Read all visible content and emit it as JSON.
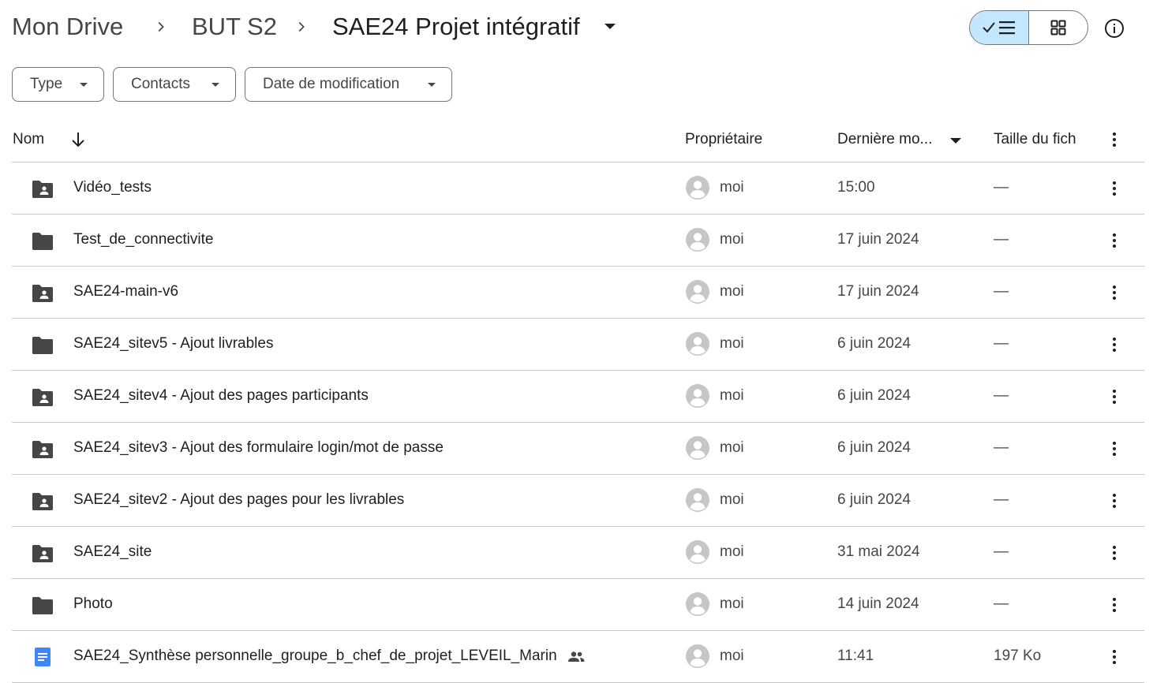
{
  "breadcrumb": {
    "items": [
      "Mon Drive",
      "BUT S2",
      "SAE24 Projet intégratif"
    ]
  },
  "icons": {
    "separator": "chevron-right-icon",
    "list_view": "list-view-icon",
    "grid_view": "grid-view-icon",
    "info": "info-icon"
  },
  "filters": [
    {
      "label": "Type"
    },
    {
      "label": "Contacts"
    },
    {
      "label": "Date de modification"
    }
  ],
  "table": {
    "columns": {
      "name": "Nom",
      "owner": "Propriétaire",
      "modified": "Dernière mo...",
      "size": "Taille du fich"
    },
    "rows": [
      {
        "type": "shared-folder",
        "name": "Vidéo_tests",
        "owner": "moi",
        "modified": "15:00",
        "size": "—"
      },
      {
        "type": "folder",
        "name": "Test_de_connectivite",
        "owner": "moi",
        "modified": "17 juin 2024",
        "size": "—"
      },
      {
        "type": "shared-folder",
        "name": "SAE24-main-v6",
        "owner": "moi",
        "modified": "17 juin 2024",
        "size": "—"
      },
      {
        "type": "folder",
        "name": "SAE24_sitev5 - Ajout livrables",
        "owner": "moi",
        "modified": "6 juin 2024",
        "size": "—"
      },
      {
        "type": "shared-folder",
        "name": "SAE24_sitev4 - Ajout des pages participants",
        "owner": "moi",
        "modified": "6 juin 2024",
        "size": "—"
      },
      {
        "type": "shared-folder",
        "name": "SAE24_sitev3 - Ajout des formulaire login/mot de passe",
        "owner": "moi",
        "modified": "6 juin 2024",
        "size": "—"
      },
      {
        "type": "shared-folder",
        "name": "SAE24_sitev2 - Ajout des pages pour les livrables",
        "owner": "moi",
        "modified": "6 juin 2024",
        "size": "—"
      },
      {
        "type": "shared-folder",
        "name": "SAE24_site",
        "owner": "moi",
        "modified": "31 mai 2024",
        "size": "—"
      },
      {
        "type": "folder",
        "name": "Photo",
        "owner": "moi",
        "modified": "14 juin 2024",
        "size": "—"
      },
      {
        "type": "doc",
        "name": "SAE24_Synthèse personnelle_groupe_b_chef_de_projet_LEVEIL_Marin",
        "shared": true,
        "owner": "moi",
        "modified": "11:41",
        "size": "197 Ko"
      }
    ]
  },
  "colors": {
    "selected_view_bg": "#c2e7ff",
    "folder": "#444746",
    "doc": "#4285f4",
    "divider": "#c4c7c5"
  }
}
